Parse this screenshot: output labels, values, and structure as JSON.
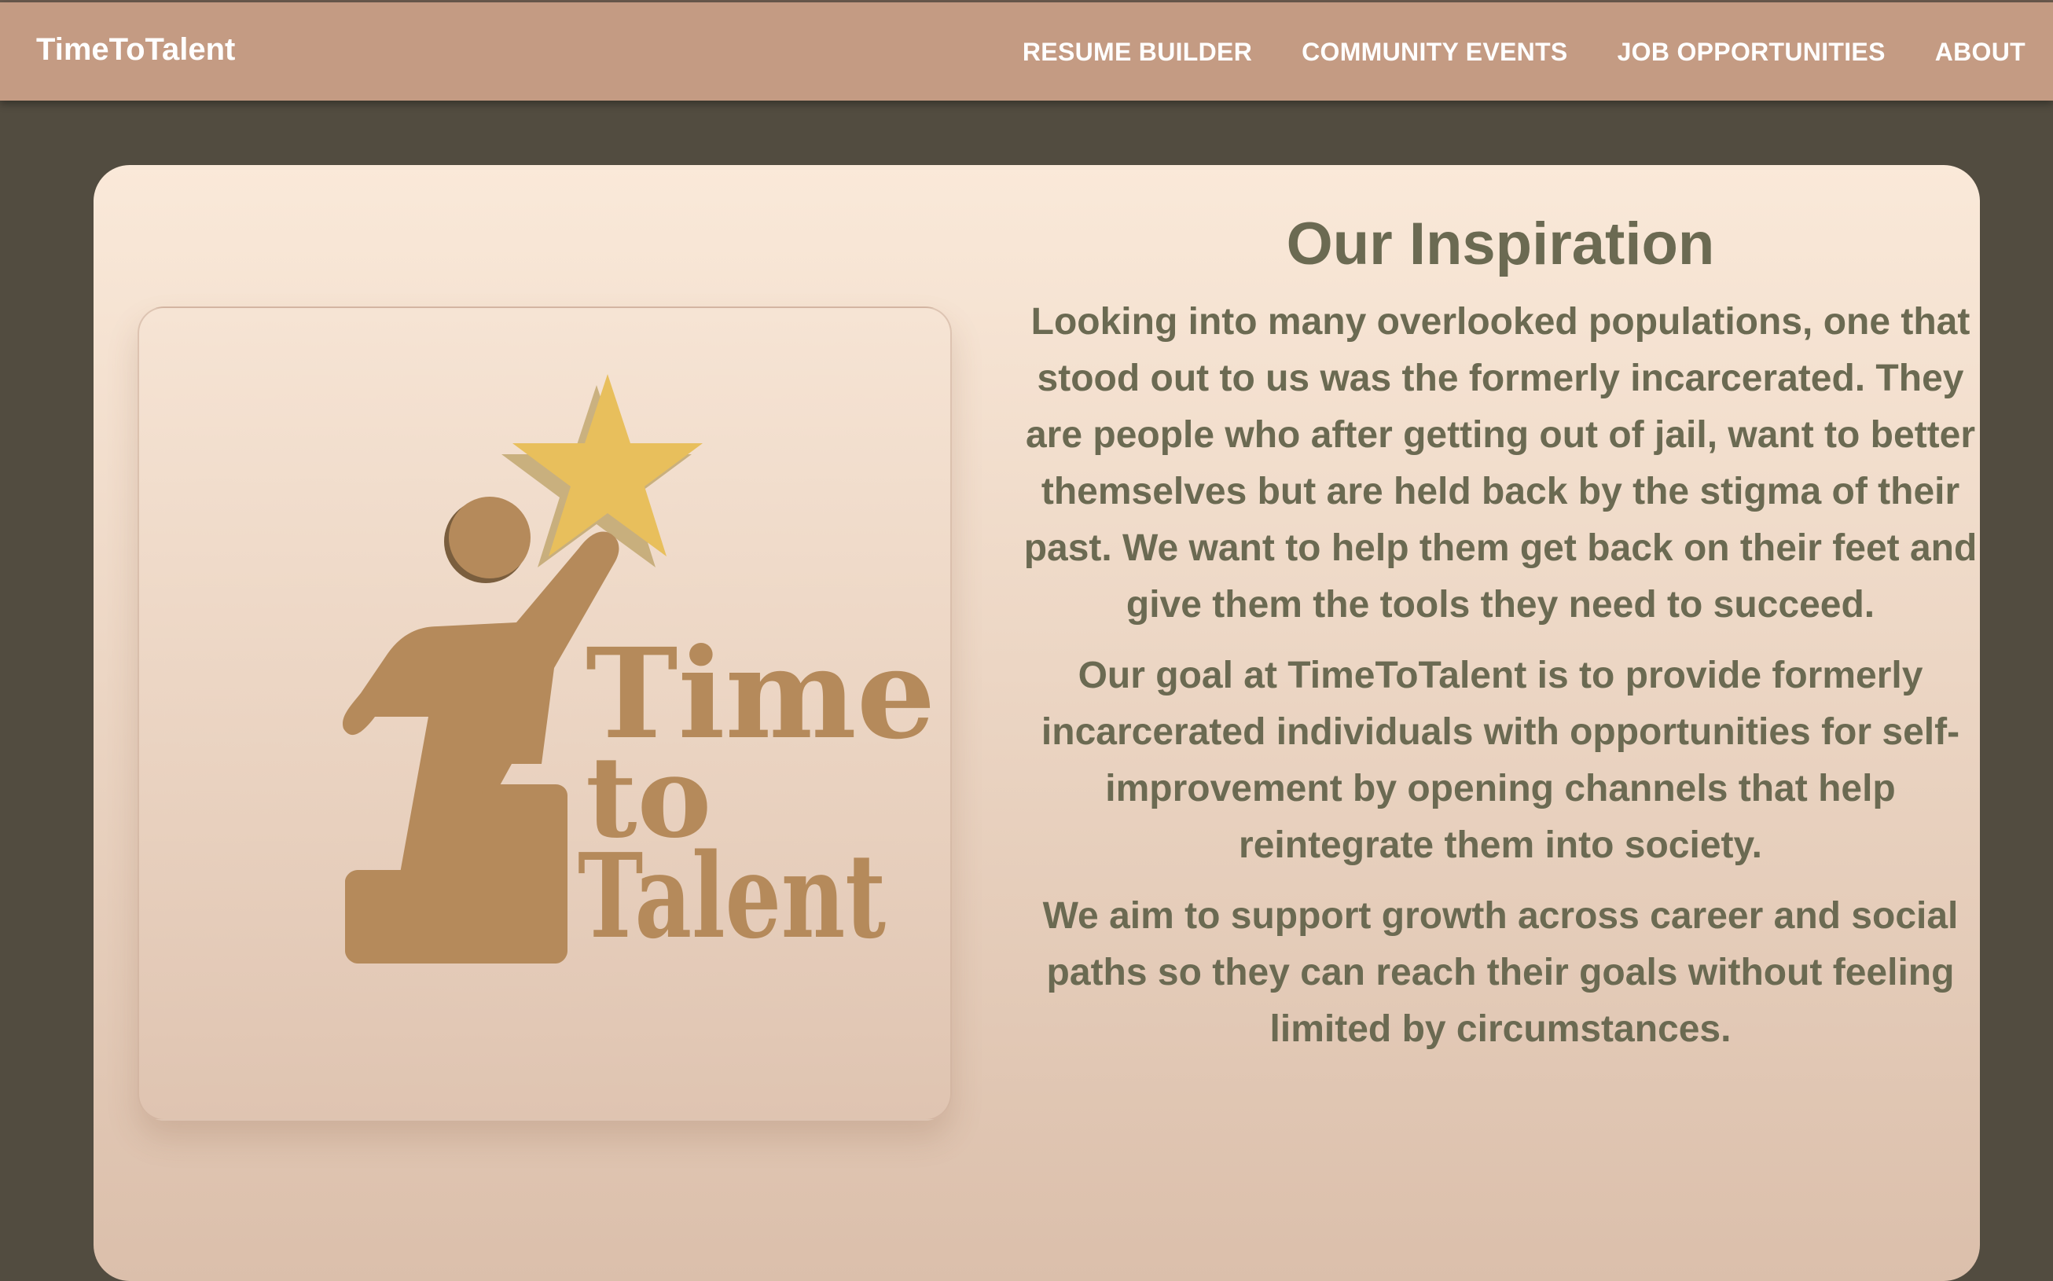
{
  "navbar": {
    "brand": "TimeToTalent",
    "links": [
      {
        "label": "RESUME BUILDER"
      },
      {
        "label": "COMMUNITY EVENTS"
      },
      {
        "label": "JOB OPPORTUNITIES"
      },
      {
        "label": "ABOUT"
      }
    ]
  },
  "logo": {
    "word_1": "Time",
    "word_2": "to",
    "word_3": "Talent",
    "icon": "person-reaching-star-icon",
    "colors": {
      "figure": "#b58a5b",
      "star": "#e8bf5c"
    }
  },
  "content": {
    "heading": "Our Inspiration",
    "paragraphs": [
      "Looking into many overlooked populations, one that stood out to us was the formerly incarcerated. They are people who after getting out of jail, want to better themselves but are held back by the stigma of their past. We want to help them get back on their feet and give them the tools they need to succeed.",
      "Our goal at TimeToTalent is to provide formerly incarcerated individuals with opportunities for self-improvement by opening channels that help reintegrate them into society.",
      "We aim to support growth across career and social paths so they can reach their goals without feeling limited by circumstances."
    ]
  },
  "theme": {
    "navbar_bg": "#c49b83",
    "page_bg": "#524c40",
    "text_color": "#6b6a52"
  }
}
